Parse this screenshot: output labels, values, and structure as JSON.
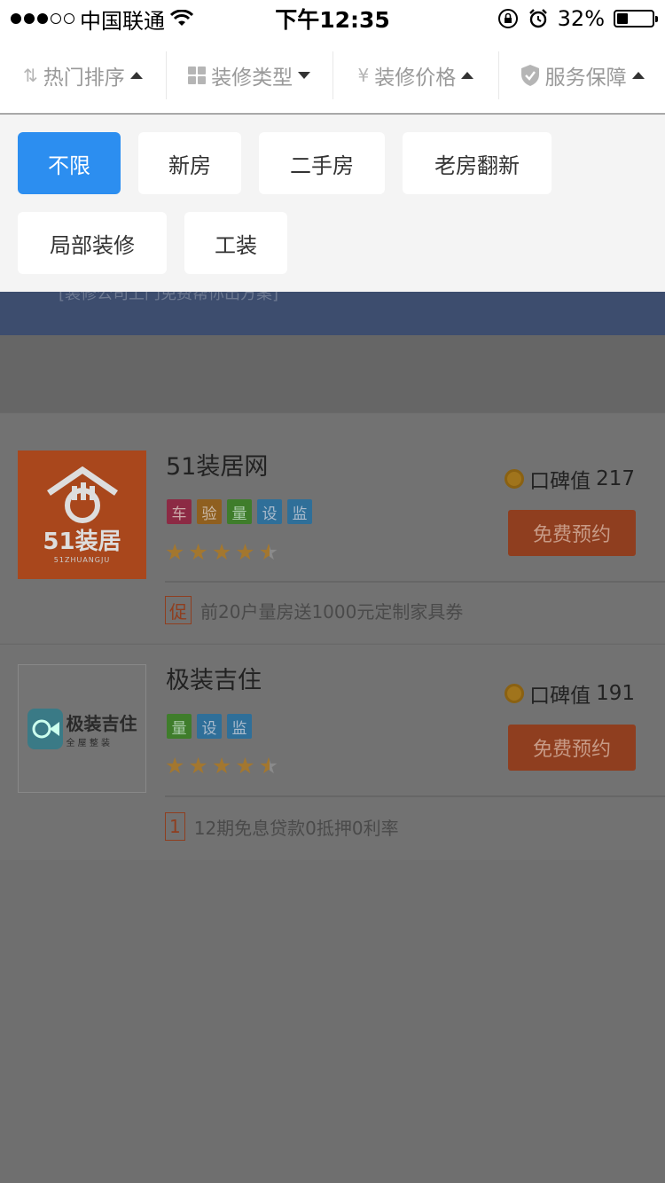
{
  "status_bar": {
    "carrier": "中国联通",
    "time": "下午12:35",
    "battery_percent": "32%",
    "battery_level": 0.32,
    "icons": [
      "signal-dots-icon",
      "wifi-icon",
      "rotation-lock-icon",
      "alarm-icon",
      "battery-icon"
    ]
  },
  "filters": [
    {
      "label": "热门排序",
      "icon": "sort-icon",
      "caret": "up"
    },
    {
      "label": "装修类型",
      "icon": "grid-icon",
      "caret": "down"
    },
    {
      "label": "装修价格",
      "icon": "yen-icon",
      "caret": "up"
    },
    {
      "label": "服务保障",
      "icon": "shield-icon",
      "caret": "up"
    }
  ],
  "filter_icon_glyphs": {
    "sort": "⇅",
    "yen": "¥"
  },
  "type_options": [
    "不限",
    "新房",
    "二手房",
    "老房翻新",
    "局部装修",
    "工装"
  ],
  "selected_option": "不限",
  "banner": {
    "text": "[装修公司上门免费帮你出方案]"
  },
  "companies": [
    {
      "name": "51装居网",
      "logo_text": "51装居",
      "logo_subtext": "51ZHUANGJU",
      "tags": [
        "车",
        "验",
        "量",
        "设",
        "监"
      ],
      "rating": 4.5,
      "reputation_label": "口碑值",
      "reputation_value": "217",
      "book_label": "免费预约",
      "promo_badge": "促",
      "promo_text": "前20户量房送1000元定制家具券"
    },
    {
      "name": "极装吉住",
      "logo_text": "极装吉住",
      "logo_subtext": "全 屋 整 装",
      "tags": [
        "量",
        "设",
        "监"
      ],
      "rating": 4.5,
      "reputation_label": "口碑值",
      "reputation_value": "191",
      "book_label": "免费预约",
      "promo_badge": "1",
      "promo_text": "12期免息贷款0抵押0利率"
    }
  ],
  "tag_colors": {
    "车": "#8c2a44",
    "验": "#8f5f1f",
    "量": "#3f7d2b",
    "设": "#2f6f99",
    "监": "#2f6f99"
  },
  "colors": {
    "accent_blue": "#2c8ef0",
    "overlay": "#6f6f6f",
    "book_button": "#8f3e1f"
  }
}
